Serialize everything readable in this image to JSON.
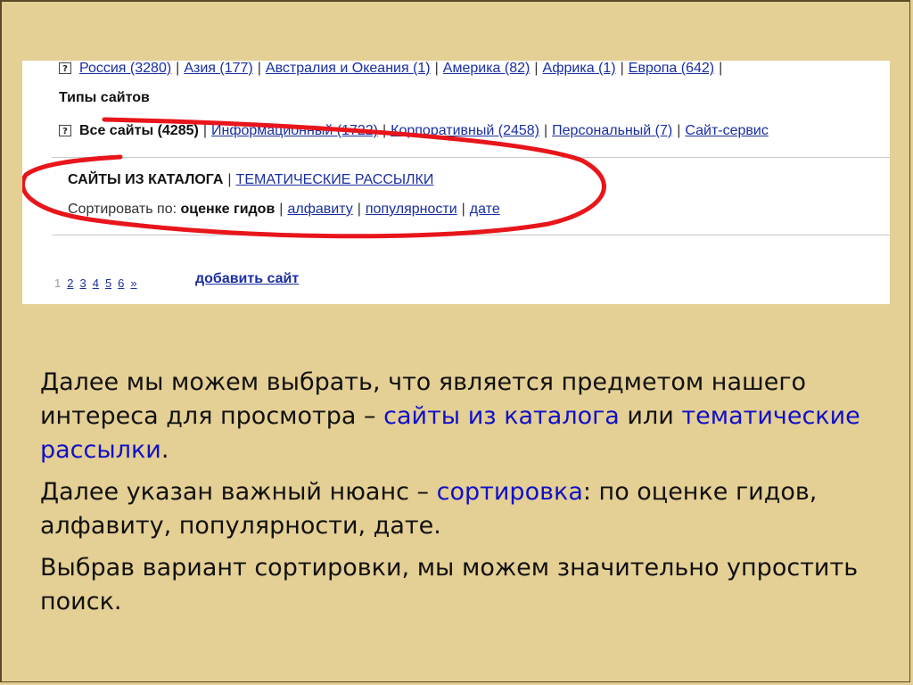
{
  "colors": {
    "background": "#e4cf94",
    "link": "#1a2ea0",
    "highlight": "#1010c8",
    "annotation": "#e8151b"
  },
  "screenshot": {
    "help_icon": "?",
    "regions": [
      {
        "label": "Россия (3280)"
      },
      {
        "label": "Азия (177)"
      },
      {
        "label": "Австралия и Океания (1)"
      },
      {
        "label": "Америка (82)"
      },
      {
        "label": "Африка (1)"
      },
      {
        "label": "Европа (642)"
      }
    ],
    "types_heading": "Типы сайтов",
    "site_types": {
      "all": "Все сайты (4285)",
      "items": [
        {
          "label": "Информационный (1722)"
        },
        {
          "label": "Корпоративный (2458)"
        },
        {
          "label": "Персональный (7)"
        },
        {
          "label": "Сайт-сервис"
        }
      ]
    },
    "sections": {
      "active": "САЙТЫ ИЗ КАТАЛОГА",
      "other": "ТЕМАТИЧЕСКИЕ РАССЫЛКИ"
    },
    "sort": {
      "label": "Сортировать по:",
      "active": "оценке гидов",
      "options": [
        {
          "label": "алфавиту"
        },
        {
          "label": "популярности"
        },
        {
          "label": "дате"
        }
      ]
    },
    "pager": {
      "current": "1",
      "pages": [
        "2",
        "3",
        "4",
        "5",
        "6",
        "»"
      ]
    },
    "add_site": "добавить сайт"
  },
  "text": {
    "p1_a": "Далее мы можем выбрать, что является предметом нашего интереса для просмотра – ",
    "p1_hl1": "сайты из каталога",
    "p1_b": " или ",
    "p1_hl2": "тематические рассылки",
    "p1_c": ".",
    "p2_a": "Далее указан важный нюанс – ",
    "p2_hl": "сортировка",
    "p2_b": ": по оценке гидов, алфавиту, популярности, дате.",
    "p3": "Выбрав вариант сортировки, мы можем значительно упростить поиск."
  }
}
